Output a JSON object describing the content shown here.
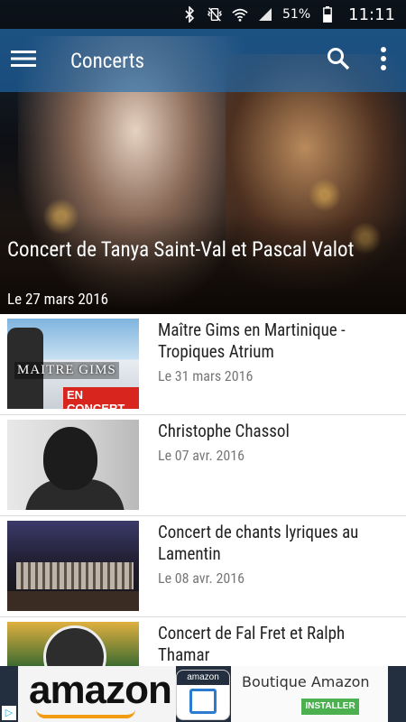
{
  "status_bar": {
    "battery_percent": "51%",
    "time": "11:11",
    "icons": [
      "bluetooth-icon",
      "vibrate-icon",
      "wifi-icon",
      "signal-icon",
      "battery-icon"
    ]
  },
  "app_bar": {
    "title": "Concerts",
    "menu_icon": "hamburger-menu-icon",
    "search_icon": "search-icon",
    "overflow_icon": "more-vert-icon",
    "color": "#1e6eb4"
  },
  "featured": {
    "title": "Concert de Tanya Saint-Val et Pascal Valot",
    "date": "Le 27 mars 2016"
  },
  "concerts": [
    {
      "title": "Maître Gims en Martinique - Tropiques Atrium",
      "date": "Le 31 mars 2016",
      "thumb_text": "MAITRE GIMS",
      "thumb_badge": "EN CONCERT"
    },
    {
      "title": "Christophe Chassol",
      "date": "Le 07 avr. 2016"
    },
    {
      "title": "Concert de chants lyriques au Lamentin",
      "date": "Le 08 avr. 2016"
    },
    {
      "title": "Concert de Fal Fret et Ralph Thamar",
      "date": ""
    }
  ],
  "ad": {
    "brand": "amazon",
    "tile_label": "amazon",
    "title": "Boutique Amazon",
    "install_label": "INSTALLER",
    "adchoices_icon": "adchoices-icon"
  }
}
